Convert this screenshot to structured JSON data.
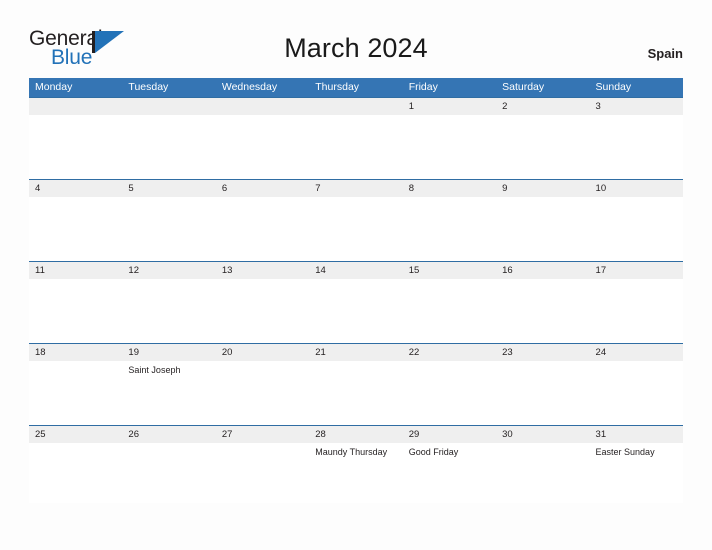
{
  "logo": {
    "word_one": "General",
    "word_two": "Blue",
    "flag_icon": "flag-triangle-icon"
  },
  "header": {
    "title": "March 2024",
    "country": "Spain"
  },
  "calendar": {
    "weekdays": [
      "Monday",
      "Tuesday",
      "Wednesday",
      "Thursday",
      "Friday",
      "Saturday",
      "Sunday"
    ],
    "colors": {
      "header_blue": "#3575b4",
      "row_divider_blue": "#2f6da3",
      "date_strip_gray": "#efefef",
      "logo_blue": "#2272b8",
      "text_dark": "#231f20"
    },
    "weeks": [
      {
        "days": [
          {
            "date": "",
            "event": ""
          },
          {
            "date": "",
            "event": ""
          },
          {
            "date": "",
            "event": ""
          },
          {
            "date": "",
            "event": ""
          },
          {
            "date": "1",
            "event": ""
          },
          {
            "date": "2",
            "event": ""
          },
          {
            "date": "3",
            "event": ""
          }
        ]
      },
      {
        "days": [
          {
            "date": "4",
            "event": ""
          },
          {
            "date": "5",
            "event": ""
          },
          {
            "date": "6",
            "event": ""
          },
          {
            "date": "7",
            "event": ""
          },
          {
            "date": "8",
            "event": ""
          },
          {
            "date": "9",
            "event": ""
          },
          {
            "date": "10",
            "event": ""
          }
        ]
      },
      {
        "days": [
          {
            "date": "11",
            "event": ""
          },
          {
            "date": "12",
            "event": ""
          },
          {
            "date": "13",
            "event": ""
          },
          {
            "date": "14",
            "event": ""
          },
          {
            "date": "15",
            "event": ""
          },
          {
            "date": "16",
            "event": ""
          },
          {
            "date": "17",
            "event": ""
          }
        ]
      },
      {
        "days": [
          {
            "date": "18",
            "event": ""
          },
          {
            "date": "19",
            "event": "Saint Joseph"
          },
          {
            "date": "20",
            "event": ""
          },
          {
            "date": "21",
            "event": ""
          },
          {
            "date": "22",
            "event": ""
          },
          {
            "date": "23",
            "event": ""
          },
          {
            "date": "24",
            "event": ""
          }
        ]
      },
      {
        "days": [
          {
            "date": "25",
            "event": ""
          },
          {
            "date": "26",
            "event": ""
          },
          {
            "date": "27",
            "event": ""
          },
          {
            "date": "28",
            "event": "Maundy Thursday"
          },
          {
            "date": "29",
            "event": "Good Friday"
          },
          {
            "date": "30",
            "event": ""
          },
          {
            "date": "31",
            "event": "Easter Sunday"
          }
        ]
      }
    ]
  }
}
